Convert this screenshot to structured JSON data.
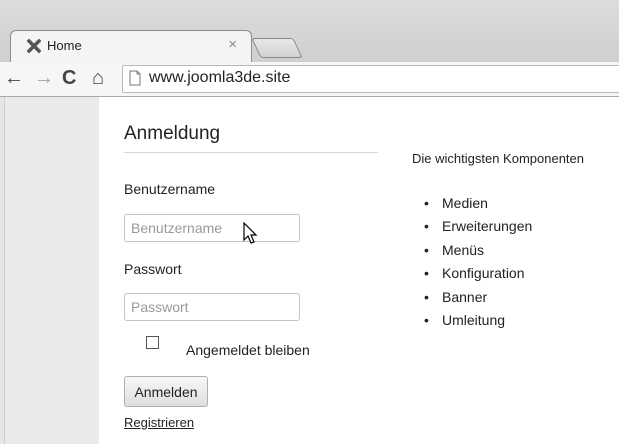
{
  "browser": {
    "tab_title": "Home",
    "tab_close": "×",
    "url": "www.joomla3de.site",
    "nav": {
      "back": "←",
      "forward": "→",
      "reload": "C",
      "home": "⌂"
    },
    "icons": [
      "joomla-favicon-icon",
      "page-icon",
      "back-arrow-icon",
      "forward-arrow-icon",
      "reload-icon",
      "home-icon"
    ]
  },
  "login": {
    "title": "Anmeldung",
    "username_label": "Benutzername",
    "username_placeholder": "Benutzername",
    "password_label": "Passwort",
    "password_placeholder": "Passwort",
    "remember_label": "Angemeldet bleiben",
    "submit_label": "Anmelden",
    "register_link": "Registrieren"
  },
  "components": {
    "intro": "Die wichtigsten Komponenten",
    "items": [
      "Medien",
      "Erweiterungen",
      "Menüs",
      "Konfiguration",
      "Banner",
      "Umleitung"
    ]
  }
}
